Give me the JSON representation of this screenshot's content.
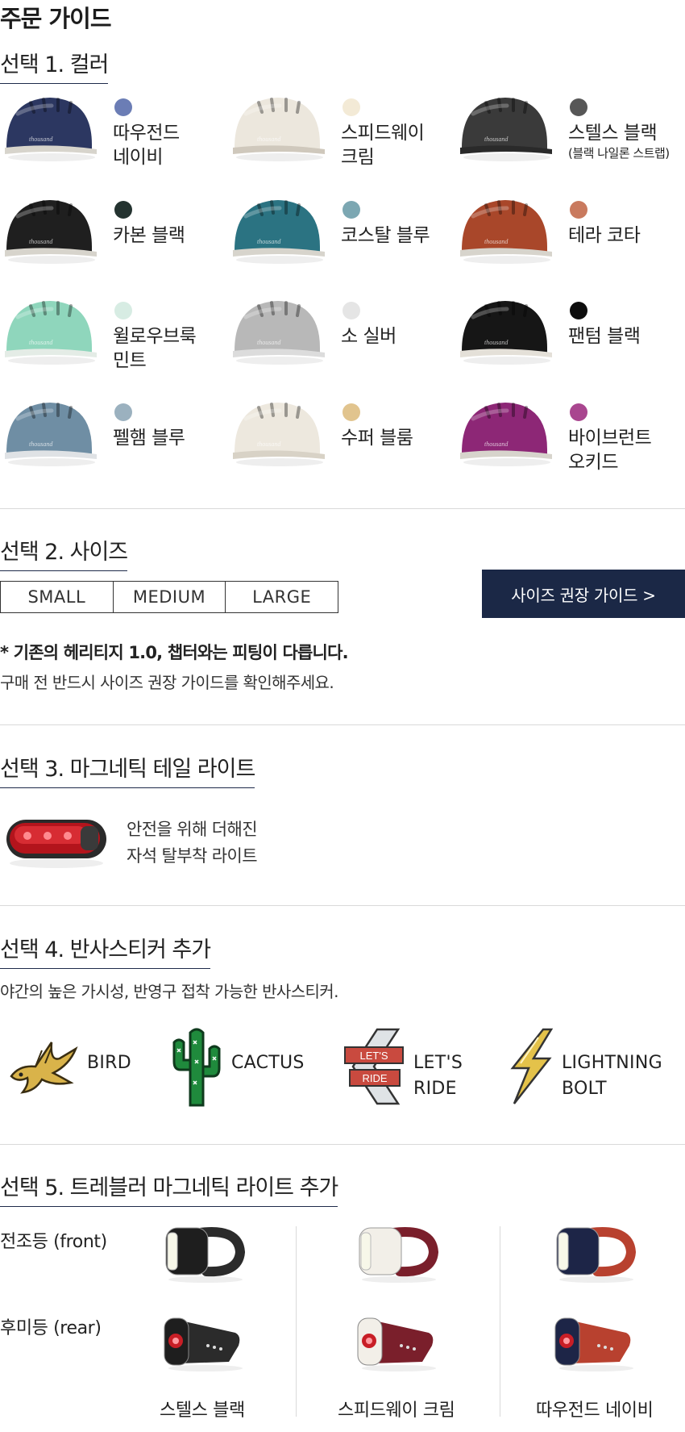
{
  "page_title": "주문 가이드",
  "section1": {
    "title": "선택 1.  컬러",
    "colors": [
      {
        "name_l1": "따우전드",
        "name_l2": "네이비",
        "sub": "",
        "dot": "#6b7db5",
        "shell": "#2c3761",
        "brim": "#d7d4cc"
      },
      {
        "name_l1": "스피드웨이",
        "name_l2": "크림",
        "sub": "",
        "dot": "#f3ead6",
        "shell": "#ece7dd",
        "brim": "#cfc8bc"
      },
      {
        "name_l1": "스텔스 블랙",
        "name_l2": "",
        "sub": "(블랙 나일론 스트랩)",
        "dot": "#575757",
        "shell": "#3a3a3a",
        "brim": "#2a2a2a"
      },
      {
        "name_l1": "카본 블랙",
        "name_l2": "",
        "sub": "",
        "dot": "#243330",
        "shell": "#1f1f1f",
        "brim": "#d7d4cc"
      },
      {
        "name_l1": "코스탈 블루",
        "name_l2": "",
        "sub": "",
        "dot": "#7ca7b2",
        "shell": "#2b7382",
        "brim": "#d7d4cc"
      },
      {
        "name_l1": "테라 코타",
        "name_l2": "",
        "sub": "",
        "dot": "#c97a5e",
        "shell": "#a9472a",
        "brim": "#d7d4cc"
      },
      {
        "name_l1": "윌로우브룩",
        "name_l2": "민트",
        "sub": "",
        "dot": "#d7ece3",
        "shell": "#8fd6bc",
        "brim": "#e4ece6"
      },
      {
        "name_l1": "소 실버",
        "name_l2": "",
        "sub": "",
        "dot": "#e5e5e5",
        "shell": "#b8b8b8",
        "brim": "#dcdcdc"
      },
      {
        "name_l1": "팬텀 블랙",
        "name_l2": "",
        "sub": "",
        "dot": "#0d0d0d",
        "shell": "#161616",
        "brim": "#e4e0d8"
      },
      {
        "name_l1": "펠햄 블루",
        "name_l2": "",
        "sub": "",
        "dot": "#9bb1bf",
        "shell": "#6f8ea4",
        "brim": "#dfe2e5"
      },
      {
        "name_l1": "수퍼 블룸",
        "name_l2": "",
        "sub": "",
        "dot": "#e1c48e",
        "shell": "#ede8de",
        "brim": "#d8d2c6"
      },
      {
        "name_l1": "바이브런트",
        "name_l2": "오키드",
        "sub": "",
        "dot": "#a9468f",
        "shell": "#8d2776",
        "brim": "#d7d4cc"
      }
    ]
  },
  "section2": {
    "title": "선택 2.  사이즈",
    "sizes": [
      "SMALL",
      "MEDIUM",
      "LARGE"
    ],
    "guide_button": "사이즈 권장 가이드 >",
    "note_bold": "* 기존의 헤리티지 1.0, 챕터와는 피팅이 다릅니다.",
    "note": "구매 전 반드시 사이즈 권장 가이드를 확인해주세요."
  },
  "section3": {
    "title": "선택 3.  마그네틱 테일 라이트",
    "desc_l1": "안전을 위해 더해진",
    "desc_l2": "자석 탈부착 라이트"
  },
  "section4": {
    "title": "선택 4.  반사스티커 추가",
    "desc": "야간의 높은 가시성, 반영구 접착 가능한 반사스티커.",
    "stickers": [
      {
        "l1": "BIRD",
        "l2": ""
      },
      {
        "l1": "CACTUS",
        "l2": ""
      },
      {
        "l1": "LET'S",
        "l2": "RIDE"
      },
      {
        "l1": "LIGHTNING",
        "l2": "BOLT"
      }
    ],
    "lets_ride_text_1": "LET'S",
    "lets_ride_text_2": "RIDE"
  },
  "section5": {
    "title": "선택 5.  트레블러 마그네틱 라이트 추가",
    "front_label": "전조등 (front)",
    "rear_label": "후미등 (rear)",
    "variants": [
      "스텔스 블랙",
      "스피드웨이 크림",
      "따우전드 네이비"
    ],
    "variant_colors": [
      {
        "body": "#1e1e1e",
        "strap": "#2b2b2b"
      },
      {
        "body": "#f2efe8",
        "strap": "#7a1f2b"
      },
      {
        "body": "#1d2547",
        "strap": "#b8412f"
      }
    ]
  }
}
